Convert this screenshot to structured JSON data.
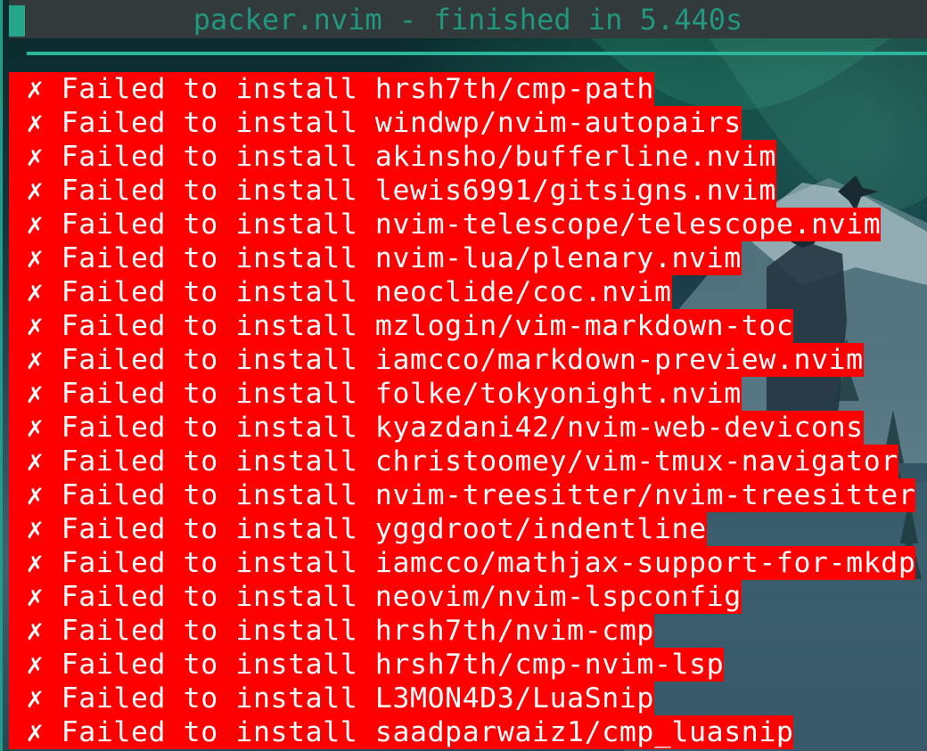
{
  "window": {
    "title": "packer.nvim - finished in 5.440s"
  },
  "colors": {
    "accent": "#2bb59a",
    "title_text": "#20987f",
    "title_bar": "#323a3c",
    "error_background": "#ff0000",
    "error_text": "#ffffff"
  },
  "icons": {
    "fail_icon": "ballot-x-icon"
  },
  "log": {
    "prefix_symbol": "✗",
    "message": "Failed to install",
    "entries": [
      "hrsh7th/cmp-path",
      "windwp/nvim-autopairs",
      "akinsho/bufferline.nvim",
      "lewis6991/gitsigns.nvim",
      "nvim-telescope/telescope.nvim",
      "nvim-lua/plenary.nvim",
      "neoclide/coc.nvim",
      "mzlogin/vim-markdown-toc",
      "iamcco/markdown-preview.nvim",
      "folke/tokyonight.nvim",
      "kyazdani42/nvim-web-devicons",
      "christoomey/vim-tmux-navigator",
      "nvim-treesitter/nvim-treesitter",
      "yggdroot/indentline",
      "iamcco/mathjax-support-for-mkdp",
      "neovim/nvim-lspconfig",
      "hrsh7th/nvim-cmp",
      "hrsh7th/cmp-nvim-lsp",
      "L3MON4D3/LuaSnip",
      "saadparwaiz1/cmp_luasnip"
    ]
  }
}
